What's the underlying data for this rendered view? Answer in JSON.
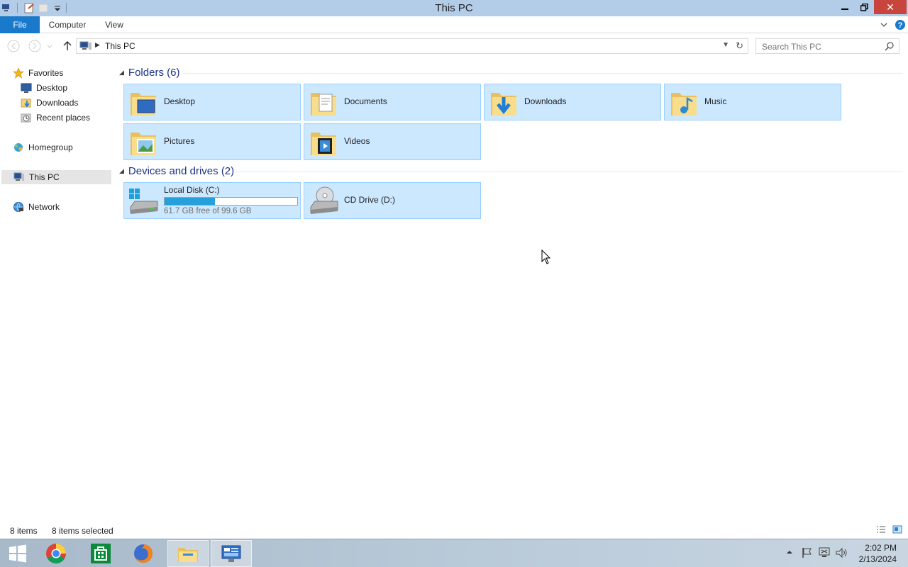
{
  "window": {
    "title": "This PC"
  },
  "ribbon": {
    "tabs": [
      "File",
      "Computer",
      "View"
    ]
  },
  "address": {
    "crumb": "This PC"
  },
  "search": {
    "placeholder": "Search This PC"
  },
  "nav": {
    "favorites": "Favorites",
    "desktop": "Desktop",
    "downloads": "Downloads",
    "recent": "Recent places",
    "homegroup": "Homegroup",
    "this_pc": "This PC",
    "network": "Network"
  },
  "folders": {
    "header": "Folders (6)",
    "items": [
      "Desktop",
      "Documents",
      "Downloads",
      "Music",
      "Pictures",
      "Videos"
    ]
  },
  "devices": {
    "header": "Devices and drives (2)",
    "local_disk": {
      "name": "Local Disk (C:)",
      "free_text": "61.7 GB free of 99.6 GB",
      "used_fraction": 0.38
    },
    "cd_drive": {
      "name": "CD Drive (D:)"
    }
  },
  "status": {
    "items": "8 items",
    "selected": "8 items selected"
  },
  "clock": {
    "time": "2:02 PM",
    "date": "2/13/2024"
  },
  "colors": {
    "file_tab": "#1979ca",
    "tile_bg": "#cce8ff",
    "tile_border": "#99d1ff",
    "close": "#c7453d"
  },
  "icons": [
    "computer-icon",
    "properties-icon",
    "folder-icon",
    "star-icon",
    "homegroup-icon",
    "network-icon",
    "drive-icon",
    "cd-icon",
    "search-icon",
    "refresh-icon"
  ]
}
